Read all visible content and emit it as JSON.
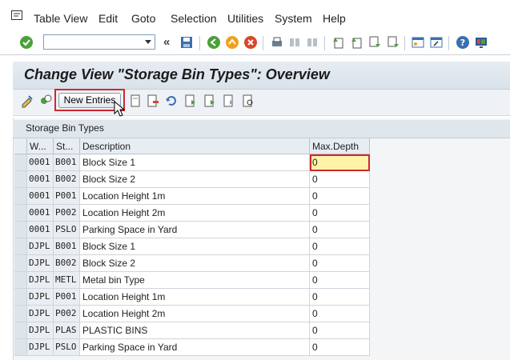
{
  "menu": {
    "items": [
      "Table View",
      "Edit",
      "Goto",
      "Selection",
      "Utilities",
      "System",
      "Help"
    ]
  },
  "toolbar": {
    "command_field_value": "",
    "icons": [
      "enter-icon",
      "back-icon",
      "save-icon",
      "back-green-icon",
      "exit-icon",
      "cancel-icon",
      "print-icon",
      "find-icon",
      "find-next-icon",
      "first-page-icon",
      "prev-page-icon",
      "next-page-icon",
      "last-page-icon",
      "create-session-icon",
      "shortcut-icon",
      "help-icon",
      "customize-layout-icon"
    ]
  },
  "title": "Change View \"Storage Bin Types\": Overview",
  "app_toolbar": {
    "new_entries_label": "New Entries"
  },
  "table": {
    "caption": "Storage Bin Types",
    "headers": {
      "warehouse": "W...",
      "storage_type": "St...",
      "description": "Description",
      "max_depth": "Max.Depth"
    },
    "rows": [
      {
        "w": "0001",
        "st": "B001",
        "desc": "Block Size 1",
        "depth": "0"
      },
      {
        "w": "0001",
        "st": "B002",
        "desc": "Block Size 2",
        "depth": "0"
      },
      {
        "w": "0001",
        "st": "P001",
        "desc": "Location Height 1m",
        "depth": "0"
      },
      {
        "w": "0001",
        "st": "P002",
        "desc": "Location Height 2m",
        "depth": "0"
      },
      {
        "w": "0001",
        "st": "PSLO",
        "desc": "Parking Space in Yard",
        "depth": "0"
      },
      {
        "w": "DJPL",
        "st": "B001",
        "desc": "Block Size 1",
        "depth": "0"
      },
      {
        "w": "DJPL",
        "st": "B002",
        "desc": "Block Size 2",
        "depth": "0"
      },
      {
        "w": "DJPL",
        "st": "METL",
        "desc": "Metal bin Type",
        "depth": "0"
      },
      {
        "w": "DJPL",
        "st": "P001",
        "desc": "Location Height 1m",
        "depth": "0"
      },
      {
        "w": "DJPL",
        "st": "P002",
        "desc": "Location Height 2m",
        "depth": "0"
      },
      {
        "w": "DJPL",
        "st": "PLAS",
        "desc": "PLASTIC BINS",
        "depth": "0"
      },
      {
        "w": "DJPL",
        "st": "PSLO",
        "desc": "Parking Space in Yard",
        "depth": "0"
      }
    ]
  },
  "colors": {
    "highlight": "#d0282e",
    "focus_field": "#fff3a8"
  }
}
